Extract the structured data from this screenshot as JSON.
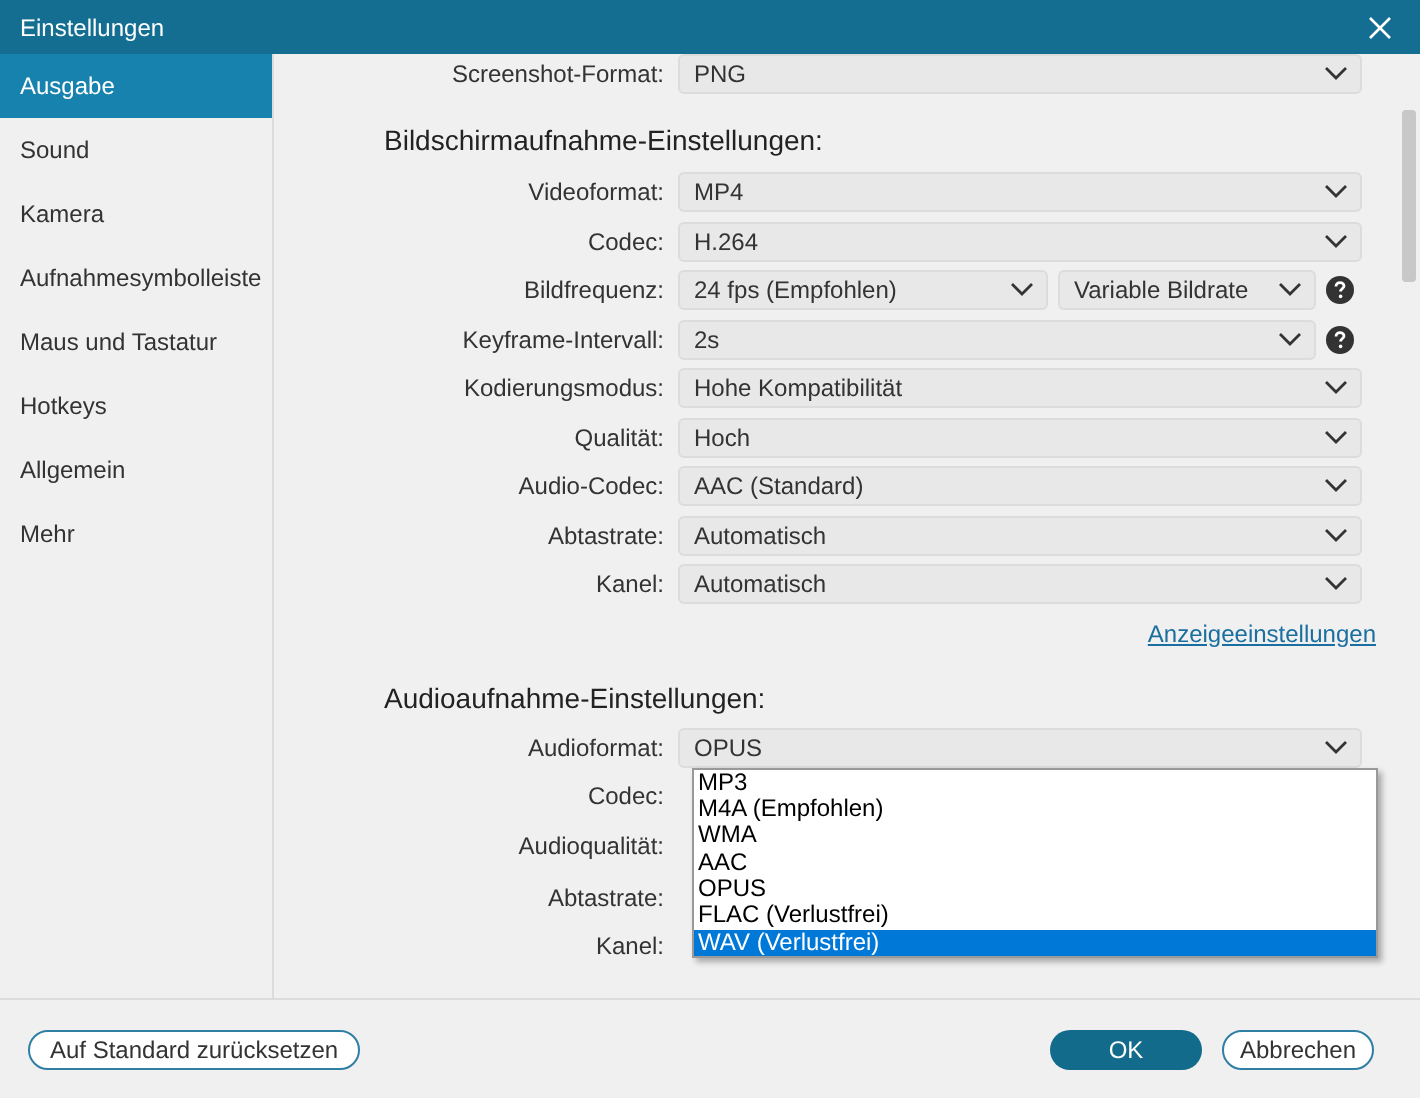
{
  "window": {
    "title": "Einstellungen"
  },
  "sidebar": {
    "items": [
      {
        "label": "Ausgabe",
        "selected": true
      },
      {
        "label": "Sound",
        "selected": false
      },
      {
        "label": "Kamera",
        "selected": false
      },
      {
        "label": "Aufnahmesymbolleiste",
        "selected": false
      },
      {
        "label": "Maus und Tastatur",
        "selected": false
      },
      {
        "label": "Hotkeys",
        "selected": false
      },
      {
        "label": "Allgemein",
        "selected": false
      },
      {
        "label": "Mehr",
        "selected": false
      }
    ]
  },
  "screenshot_format": {
    "label": "Screenshot-Format:",
    "value": "PNG"
  },
  "video_section": {
    "heading": "Bildschirmaufnahme-Einstellungen:",
    "rows": [
      {
        "label": "Videoformat:",
        "selects": [
          "MP4"
        ],
        "help": false
      },
      {
        "label": "Codec:",
        "selects": [
          "H.264"
        ],
        "help": false
      },
      {
        "label": "Bildfrequenz:",
        "selects": [
          "24 fps (Empfohlen)",
          "Variable Bildrate"
        ],
        "help": true
      },
      {
        "label": "Keyframe-Intervall:",
        "selects": [
          "2s"
        ],
        "help": true
      },
      {
        "label": "Kodierungsmodus:",
        "selects": [
          "Hohe Kompatibilität"
        ],
        "help": false
      },
      {
        "label": "Qualität:",
        "selects": [
          "Hoch"
        ],
        "help": false
      },
      {
        "label": "Audio-Codec:",
        "selects": [
          "AAC (Standard)"
        ],
        "help": false
      },
      {
        "label": "Abtastrate:",
        "selects": [
          "Automatisch"
        ],
        "help": false
      },
      {
        "label": "Kanel:",
        "selects": [
          "Automatisch"
        ],
        "help": false
      }
    ]
  },
  "display_settings_link": "Anzeigeeinstellungen",
  "audio_section": {
    "heading": "Audioaufnahme-Einstellungen:",
    "rows": [
      {
        "label": "Audioformat:",
        "selects": [
          "OPUS"
        ],
        "help": false
      },
      {
        "label": "Codec:"
      },
      {
        "label": "Audioqualität:"
      },
      {
        "label": "Abtastrate:"
      },
      {
        "label": "Kanel:"
      }
    ],
    "dropdown": {
      "options": [
        {
          "label": "MP3",
          "selected": false
        },
        {
          "label": "M4A (Empfohlen)",
          "selected": false
        },
        {
          "label": "WMA",
          "selected": false
        },
        {
          "label": "AAC",
          "selected": false
        },
        {
          "label": "OPUS",
          "selected": false
        },
        {
          "label": "FLAC (Verlustfrei)",
          "selected": false
        },
        {
          "label": "WAV (Verlustfrei)",
          "selected": true
        }
      ]
    }
  },
  "footer": {
    "reset_button": "Auf Standard zurücksetzen",
    "ok_button": "OK",
    "cancel_button": "Abbrechen"
  }
}
